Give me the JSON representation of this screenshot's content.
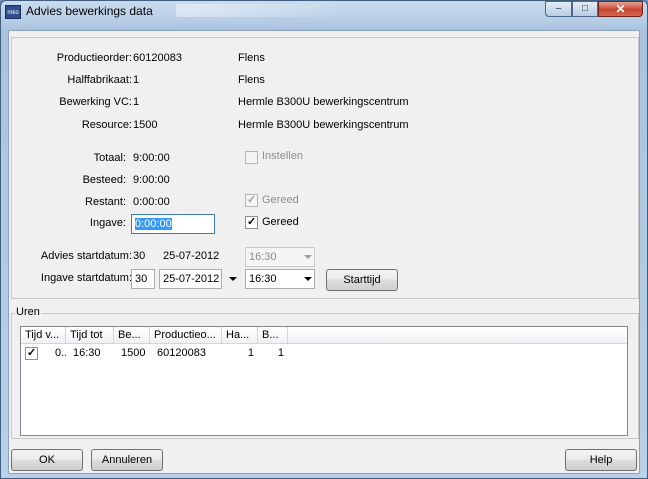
{
  "window": {
    "title": "Advies bewerkings data",
    "icon_text": "mko",
    "minimize": "–",
    "maximize": "□",
    "close": "✕"
  },
  "info": {
    "productieorder_label": "Productieorder:",
    "productieorder_value": "60120083",
    "productieorder_desc": "Flens",
    "halffabrikaat_label": "Halffabrikaat:",
    "halffabrikaat_value": "1",
    "halffabrikaat_desc": "Flens",
    "bewerking_label": "Bewerking VC:",
    "bewerking_value": "1",
    "bewerking_desc": "Hermle B300U bewerkingscentrum",
    "resource_label": "Resource:",
    "resource_value": "1500",
    "resource_desc": "Hermle B300U bewerkingscentrum"
  },
  "times": {
    "totaal_label": "Totaal:",
    "totaal_value": "9:00:00",
    "besteed_label": "Besteed:",
    "besteed_value": "9:00:00",
    "restant_label": "Restant:",
    "restant_value": "0:00:00",
    "ingave_label": "Ingave:",
    "ingave_value": "0:00:00"
  },
  "checks": {
    "instellen_label": "Instellen",
    "instellen_checked": false,
    "gereed1_label": "Gereed",
    "gereed1_checked": true,
    "gereed2_label": "Gereed",
    "gereed2_checked": true,
    "check_glyph": "✓"
  },
  "advies": {
    "label": "Advies startdatum:",
    "week": "30",
    "date": "25-07-2012",
    "time": "16:30"
  },
  "ingave_start": {
    "label": "Ingave startdatum:",
    "week": "30",
    "date": "25-07-2012",
    "time": "16:30",
    "starttijd_button": "Starttijd"
  },
  "uren": {
    "legend": "Uren",
    "columns": [
      "Tijd v...",
      "Tijd tot",
      "Be...",
      "Productieo...",
      "Ha...",
      "B..."
    ],
    "rows": [
      {
        "checked": true,
        "tijd_van": "0..",
        "tijd_tot": "16:30",
        "be": "1500",
        "productieorder": "60120083",
        "ha": "1",
        "b": "1"
      }
    ]
  },
  "footer": {
    "ok": "OK",
    "annuleren": "Annuleren",
    "help": "Help"
  }
}
